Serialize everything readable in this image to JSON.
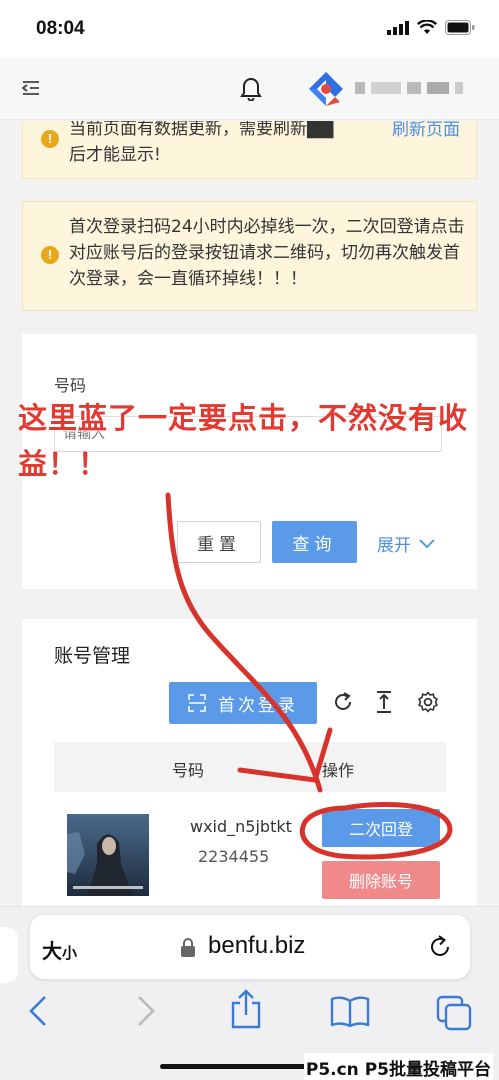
{
  "status_bar": {
    "time": "08:04"
  },
  "header": {
    "menu_icon": "menu-collapse-icon",
    "bell_icon": "bell-icon",
    "logo_icon": "diamond-logo-icon"
  },
  "alerts": {
    "data_update": {
      "text": "当前页面有数据更新，需要刷新██后才能显示!",
      "action": "刷新页面"
    },
    "login_notice": {
      "text": "首次登录扫码24小时内必掉线一次，二次回登请点击对应账号后的登录按钮请求二维码，切勿再次触发首次登录，会一直循环掉线！！！"
    }
  },
  "search": {
    "label": "号码",
    "placeholder": "请输入",
    "reset_label": "重置",
    "query_label": "查询",
    "expand_label": "展开"
  },
  "accounts": {
    "title": "账号管理",
    "first_login_label": "首次登录",
    "columns": {
      "number": "号码",
      "operations": "操作"
    },
    "rows": [
      {
        "wxid": "wxid_n5jbtkt",
        "number": "2234455",
        "relogin_label": "二次回登",
        "delete_label": "删除账号"
      }
    ]
  },
  "annotation": {
    "text": "这里蓝了一定要点击，不然没有收益！！"
  },
  "browser": {
    "text_size": "大",
    "text_size_small": "小",
    "url": "benfu.biz"
  },
  "watermark": "P5.cn P5批量投稿平台",
  "colors": {
    "primary": "#5b9ae8",
    "danger": "#f08a8a",
    "warning_bg": "#fdf5dc",
    "annotation": "#e23a30"
  }
}
